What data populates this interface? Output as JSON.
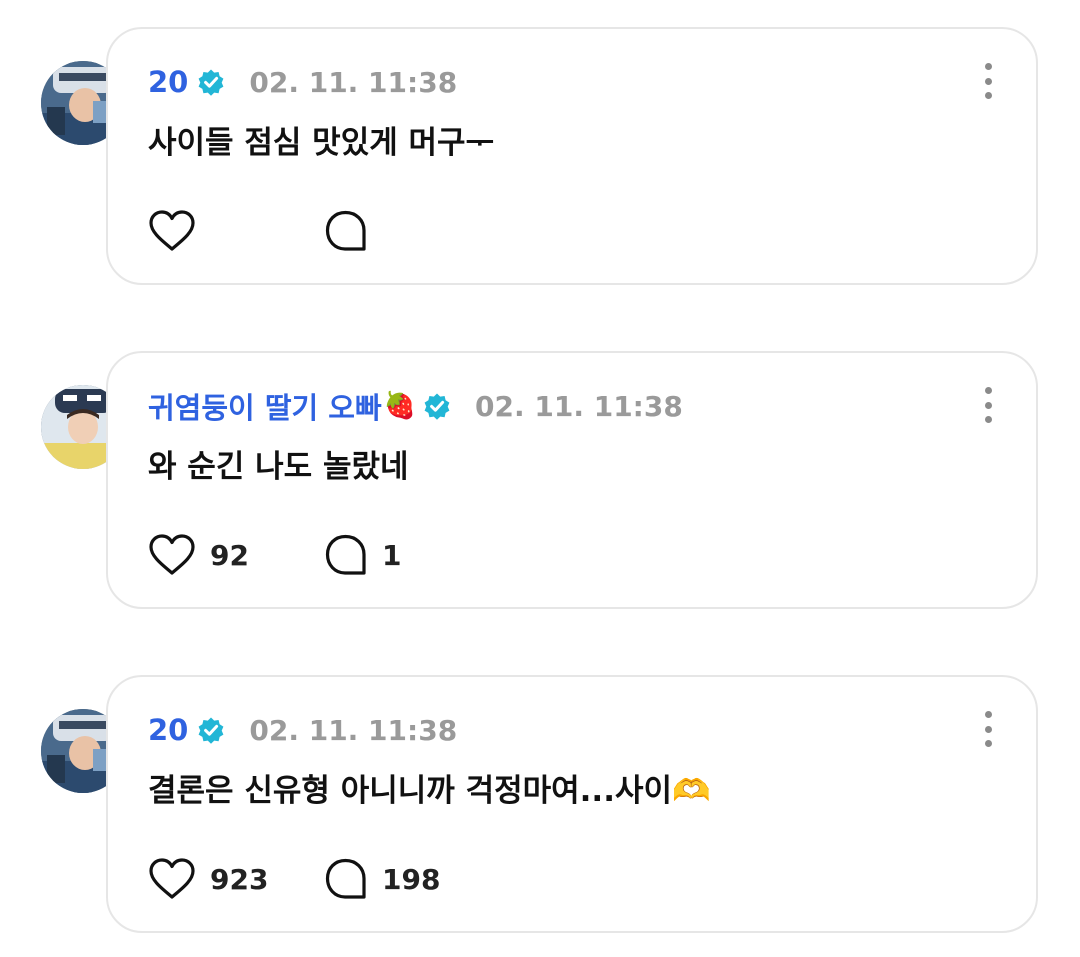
{
  "comments": [
    {
      "author": "20",
      "author_emoji": "",
      "verified": true,
      "timestamp": "02. 11. 11:38",
      "text": "사이들 점심 맛있게 머구ᅮ",
      "likes": "",
      "replies": ""
    },
    {
      "author": "귀염둥이 딸기 오빠",
      "author_emoji": "🍓",
      "verified": true,
      "timestamp": "02. 11. 11:38",
      "text": "와 순긴 나도 놀랐네",
      "likes": "92",
      "replies": "1"
    },
    {
      "author": "20",
      "author_emoji": "",
      "verified": true,
      "timestamp": "02. 11. 11:38",
      "text": "결론은 신유형 아니니까 걱정마여...사이🫶",
      "likes": "923",
      "replies": "198"
    }
  ],
  "icons": {
    "verified": "verified-badge-icon",
    "like": "heart-icon",
    "reply": "speech-bubble-icon",
    "more": "more-vertical-icon"
  },
  "colors": {
    "author_name": "#2f62e0",
    "verified_badge": "#22b6d6",
    "timestamp": "#9a9a9a",
    "card_border": "#e6e6e6"
  }
}
